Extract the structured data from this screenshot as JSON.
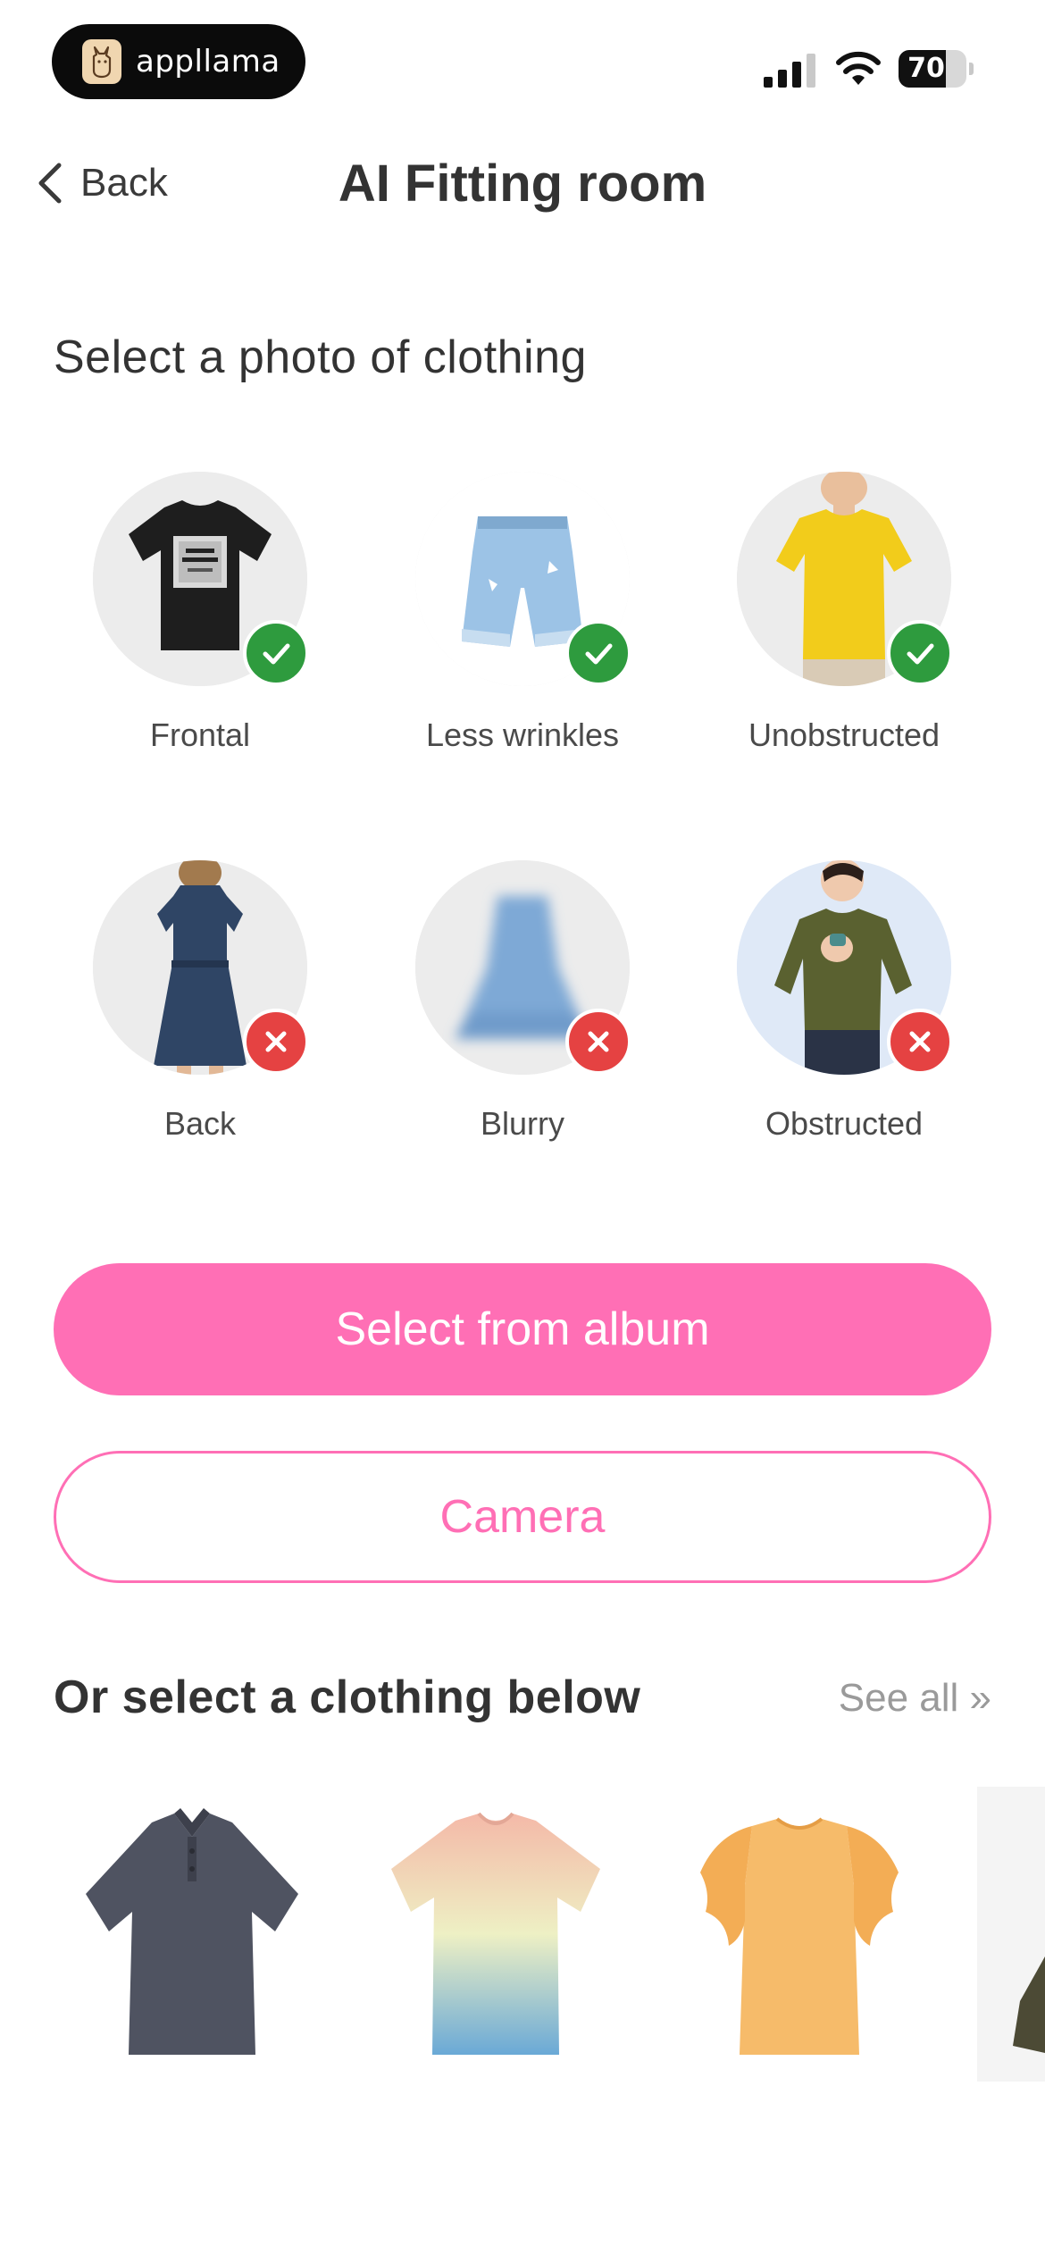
{
  "status_bar": {
    "app_name": "appllama",
    "battery_percent": 70,
    "battery_label": "70"
  },
  "nav": {
    "back_label": "Back",
    "title": "AI Fitting room"
  },
  "section_select_photo": {
    "heading": "Select a photo of clothing",
    "examples": [
      {
        "label": "Frontal",
        "status": "good",
        "icon": "black-tshirt-icon"
      },
      {
        "label": "Less wrinkles",
        "status": "good",
        "icon": "denim-shorts-icon"
      },
      {
        "label": "Unobstructed",
        "status": "good",
        "icon": "yellow-tshirt-person-icon"
      },
      {
        "label": "Back",
        "status": "bad",
        "icon": "dress-back-icon"
      },
      {
        "label": "Blurry",
        "status": "bad",
        "icon": "blurry-skirt-icon"
      },
      {
        "label": "Obstructed",
        "status": "bad",
        "icon": "green-sweater-person-icon"
      }
    ]
  },
  "actions": {
    "select_album_label": "Select from album",
    "camera_label": "Camera"
  },
  "section_clothing": {
    "heading": "Or select a clothing below",
    "see_all_label": "See all »",
    "items": [
      {
        "icon": "grey-polo-shirt-icon"
      },
      {
        "icon": "gradient-tshirt-icon"
      },
      {
        "icon": "orange-ruffle-top-icon"
      },
      {
        "icon": "partial-clothing-icon"
      }
    ]
  },
  "colors": {
    "accent_pink": "#ff6fb5",
    "good_green": "#2e9b3e",
    "bad_red": "#e54242",
    "text_dark": "#333333",
    "text_muted": "#9a9a9a"
  }
}
